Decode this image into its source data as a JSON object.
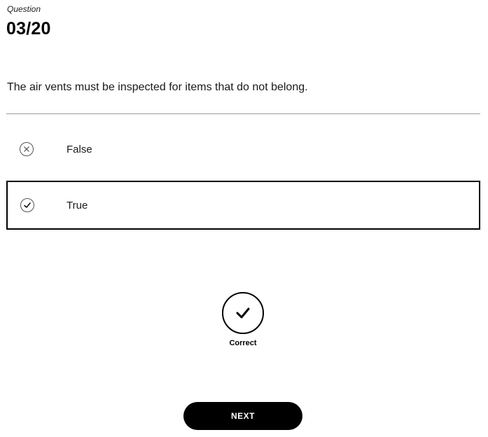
{
  "header": {
    "label": "Question",
    "counter": "03/20"
  },
  "question": {
    "text": "The air vents must be inspected for items that do not belong."
  },
  "options": [
    {
      "label": "False",
      "icon": "x-circle-icon",
      "selected": false
    },
    {
      "label": "True",
      "icon": "check-circle-icon",
      "selected": true
    }
  ],
  "feedback": {
    "icon": "checkmark-circle-icon",
    "text": "Correct"
  },
  "actions": {
    "next_label": "NEXT"
  },
  "colors": {
    "accent": "#000000",
    "divider": "#9a9a9a",
    "background": "#ffffff"
  }
}
